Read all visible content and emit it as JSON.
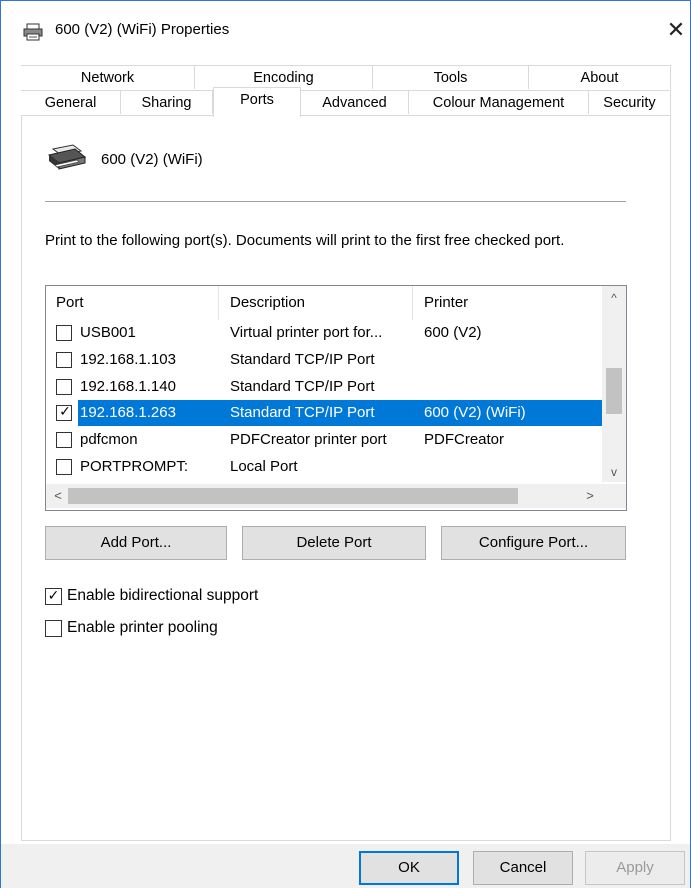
{
  "window": {
    "title": "600 (V2) (WiFi) Properties",
    "close_glyph": "✕"
  },
  "tabs": {
    "row1": [
      "Network",
      "Encoding",
      "Tools",
      "About"
    ],
    "row2": [
      "General",
      "Sharing",
      "Ports",
      "Advanced",
      "Colour Management",
      "Security"
    ],
    "active": "Ports"
  },
  "printer": {
    "name": "600 (V2) (WiFi)"
  },
  "ports": {
    "description": "Print to the following port(s). Documents will print to the first free checked port.",
    "columns": [
      "Port",
      "Description",
      "Printer"
    ],
    "rows": [
      {
        "checked": false,
        "port": "USB001",
        "description": "Virtual printer port for...",
        "printer": "600 (V2)"
      },
      {
        "checked": false,
        "port": "192.168.1.103",
        "description": "Standard TCP/IP Port",
        "printer": ""
      },
      {
        "checked": false,
        "port": "192.168.1.140",
        "description": "Standard TCP/IP Port",
        "printer": ""
      },
      {
        "checked": true,
        "port": "192.168.1.263",
        "description": "Standard TCP/IP Port",
        "printer": "600 (V2) (WiFi)"
      },
      {
        "checked": false,
        "port": "pdfcmon",
        "description": "PDFCreator printer port",
        "printer": "PDFCreator"
      },
      {
        "checked": false,
        "port": "PORTPROMPT:",
        "description": "Local Port",
        "printer": ""
      }
    ],
    "selected_row": 3,
    "check_glyph": "✓",
    "scroll_up": "^",
    "scroll_down": "v",
    "scroll_left": "<",
    "scroll_right": ">"
  },
  "buttons": {
    "add_port": "Add Port...",
    "delete_port": "Delete Port",
    "configure_port": "Configure Port...",
    "ok": "OK",
    "cancel": "Cancel",
    "apply": "Apply"
  },
  "options": {
    "bidirectional_label": "Enable bidirectional support",
    "bidirectional_checked": true,
    "pooling_label": "Enable printer pooling",
    "pooling_checked": false
  },
  "colors": {
    "selection": "#0078d7",
    "window_border": "#2b78d4"
  }
}
